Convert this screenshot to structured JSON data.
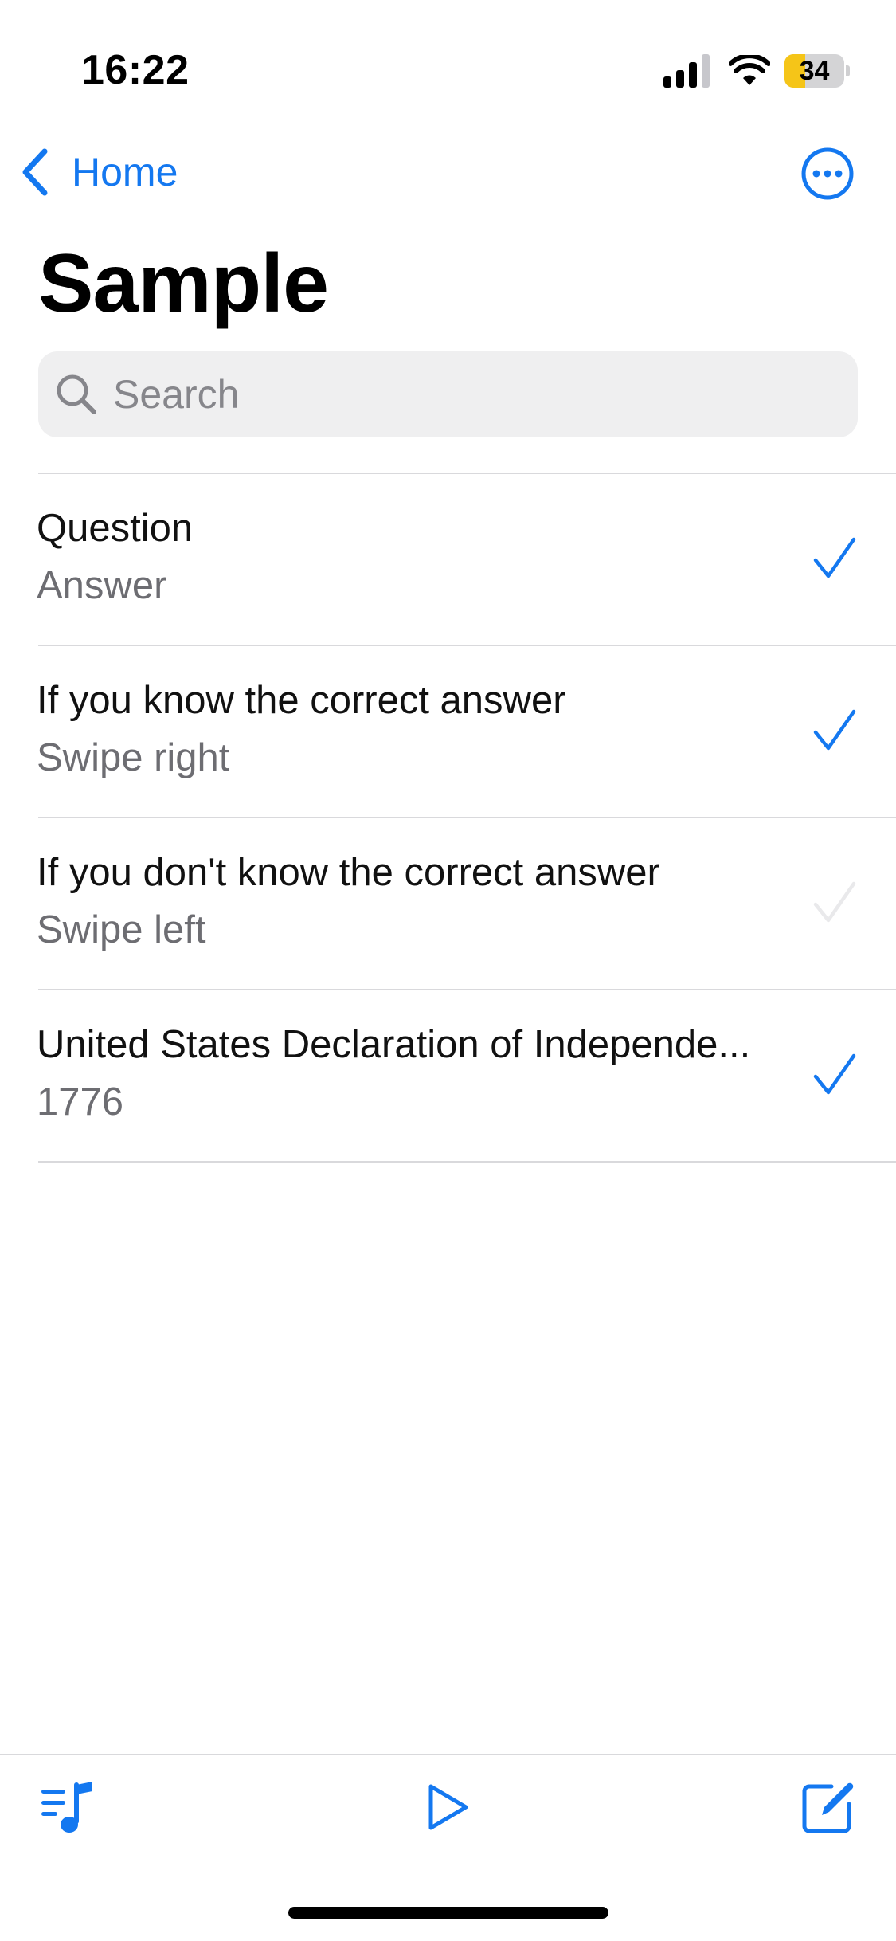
{
  "status_bar": {
    "time": "16:22",
    "battery_level": "34",
    "battery_fraction": 0.34,
    "battery_color": "#f5c518",
    "icons": [
      "signal-icon",
      "wifi-icon",
      "battery-icon"
    ]
  },
  "nav": {
    "back_label": "Home",
    "back_icon": "chevron-left-icon",
    "more_icon": "ellipsis-circle-icon"
  },
  "title": "Sample",
  "search": {
    "placeholder": "Search",
    "value": "",
    "icon": "magnifying-glass-icon"
  },
  "cards": [
    {
      "question": "Question",
      "answer": "Answer",
      "known": true
    },
    {
      "question": "If you know the correct answer",
      "answer": "Swipe right",
      "known": true
    },
    {
      "question": "If you don't know the correct answer",
      "answer": "Swipe left",
      "known": false
    },
    {
      "question": "United States Declaration of Independe...",
      "answer": "1776",
      "known": true
    }
  ],
  "toolbar": {
    "items": [
      "playlist-icon",
      "play-icon",
      "compose-icon"
    ]
  },
  "colors": {
    "accent": "#1478f0",
    "check_active": "#1478f0",
    "check_inactive": "#e9e9eb",
    "secondary_text": "#6d6d72",
    "search_background": "#efeff0"
  }
}
